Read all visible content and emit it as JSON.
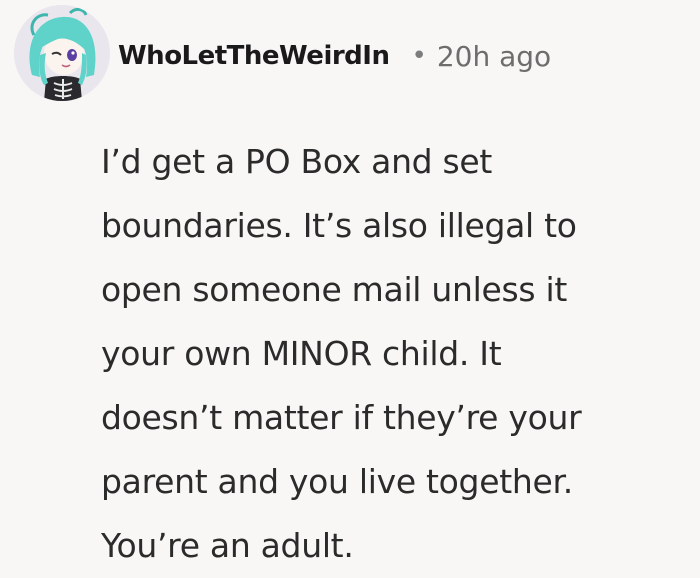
{
  "comment": {
    "username": "WhoLetTheWeirdIn",
    "separator": "•",
    "timestamp": "20h ago",
    "avatar_icon": "anime-skeleton-avatar-icon",
    "body_lines": [
      "I’d get a PO Box and set",
      "boundaries. It’s also illegal to",
      "open someone mail unless it",
      "your own MINOR child. It",
      "doesn’t matter if they’re your",
      "parent and you live together.",
      "You’re an adult."
    ]
  },
  "colors": {
    "background": "#f8f7f5",
    "username": "#1a1a1b",
    "meta": "#6d6d6d",
    "body": "#2b2b2b",
    "avatar_hair": "#5fd3c9"
  }
}
